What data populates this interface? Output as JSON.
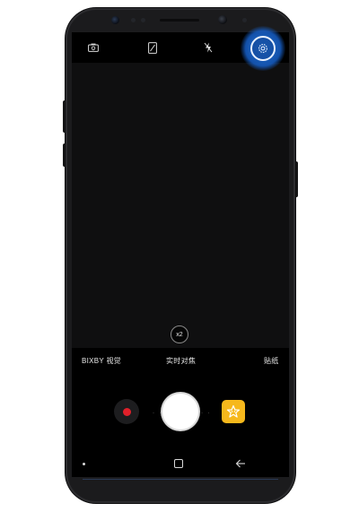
{
  "camera": {
    "zoom_label": "x2",
    "modes": [
      "BIXBY 视觉",
      "实时对焦",
      "贴纸"
    ],
    "shutter_dots": "· ·",
    "shutter_dots_right": "· ·"
  },
  "icons": {
    "switch_camera": "switch-camera-icon",
    "ratio": "aspect-ratio-icon",
    "flash": "flash-off-icon",
    "settings": "settings-gear-icon",
    "record": "record-icon",
    "sticker": "sticker-icon",
    "nav_recent": "recent-apps-icon",
    "nav_home": "home-icon",
    "nav_back": "back-arrow-icon"
  },
  "colors": {
    "record_red": "#e0202a",
    "sticker_yellow": "#f6b81c",
    "highlight_blue": "#1e6fd0"
  }
}
